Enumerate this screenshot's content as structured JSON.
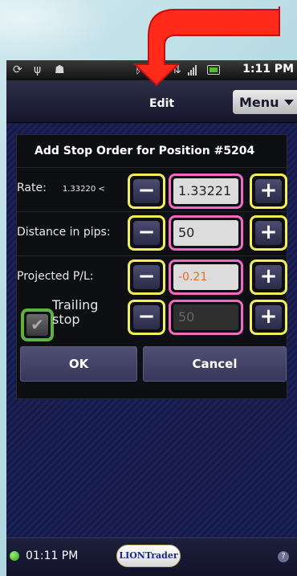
{
  "status_bar": {
    "time": "1:11 PM",
    "icons": [
      "sync-icon",
      "usb-icon",
      "android-icon",
      "bluetooth-icon",
      "data-transfer-icon",
      "signal-icon",
      "battery-icon"
    ]
  },
  "title_bar": {
    "title": "Edit",
    "menu_label": "Menu"
  },
  "dialog": {
    "title": "Add Stop Order for Position #5204",
    "rows": [
      {
        "label": "Rate:",
        "sub": "1.33220 <",
        "value": "1.33221"
      },
      {
        "label": "Distance in pips:",
        "value": "50"
      },
      {
        "label": "Projected P/L:",
        "value": "-0.21"
      },
      {
        "label": "Trailing stop",
        "value": "50",
        "checked": true
      }
    ],
    "minus": "−",
    "plus": "+",
    "ok_label": "OK",
    "cancel_label": "Cancel"
  },
  "footer": {
    "time": "01:11 PM",
    "logo": "LIONTrader",
    "help": "?"
  },
  "colors": {
    "yellow_highlight": "#f3ee55",
    "pink_highlight": "#f36ac4",
    "green_highlight": "#5fb33c",
    "arrow": "#ff2a1a"
  }
}
